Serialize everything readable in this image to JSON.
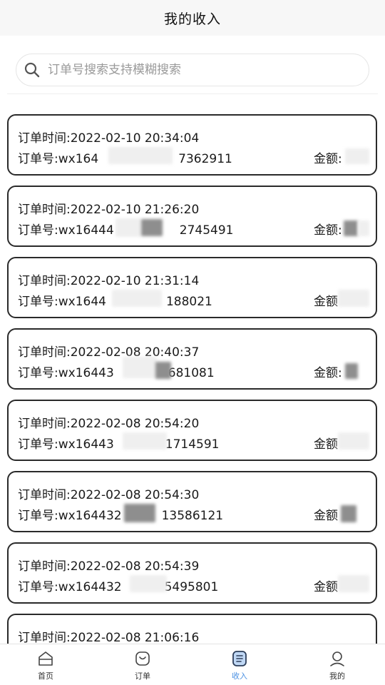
{
  "header": {
    "title": "我的收入"
  },
  "search": {
    "placeholder": "订单号搜索支持模糊搜索",
    "value": ""
  },
  "orders": [
    {
      "time": "订单时间:2022-02-10 20:34:04",
      "order_no_prefix": "订单号:wx164",
      "order_no_suffix": "7362911",
      "amount_label": "金额:"
    },
    {
      "time": "订单时间:2022-02-10 21:26:20",
      "order_no_prefix": "订单号:wx16444",
      "order_no_suffix": "2745491",
      "amount_label": "金额:"
    },
    {
      "time": "订单时间:2022-02-10 21:31:14",
      "order_no_prefix": "订单号:wx1644",
      "order_no_suffix": "188021",
      "amount_label": "金额"
    },
    {
      "time": "订单时间:2022-02-08 20:40:37",
      "order_no_prefix": "订单号:wx16443",
      "order_no_suffix": "681081",
      "amount_label": "金额:"
    },
    {
      "time": "订单时间:2022-02-08 20:54:20",
      "order_no_prefix": "订单号:wx16443",
      "order_no_suffix": "1714591",
      "amount_label": "金额"
    },
    {
      "time": "订单时间:2022-02-08 20:54:30",
      "order_no_prefix": "订单号:wx164432",
      "order_no_suffix": "13586121",
      "amount_label": "金额"
    },
    {
      "time": "订单时间:2022-02-08 20:54:39",
      "order_no_prefix": "订单号:wx164432",
      "order_no_suffix": "5495801",
      "amount_label": "金额"
    },
    {
      "time": "订单时间:2022-02-08 21:06:16",
      "order_no_prefix": "",
      "order_no_suffix": "",
      "amount_label": ""
    }
  ],
  "tabs": [
    {
      "label": "首页",
      "icon": "home-icon",
      "active": false
    },
    {
      "label": "订单",
      "icon": "order-icon",
      "active": false
    },
    {
      "label": "收入",
      "icon": "income-icon",
      "active": true
    },
    {
      "label": "我的",
      "icon": "profile-icon",
      "active": false
    }
  ],
  "colors": {
    "active_tab": "#4a90e2",
    "card_border": "#2a2a2a",
    "header_bg": "#f7f7f7"
  }
}
